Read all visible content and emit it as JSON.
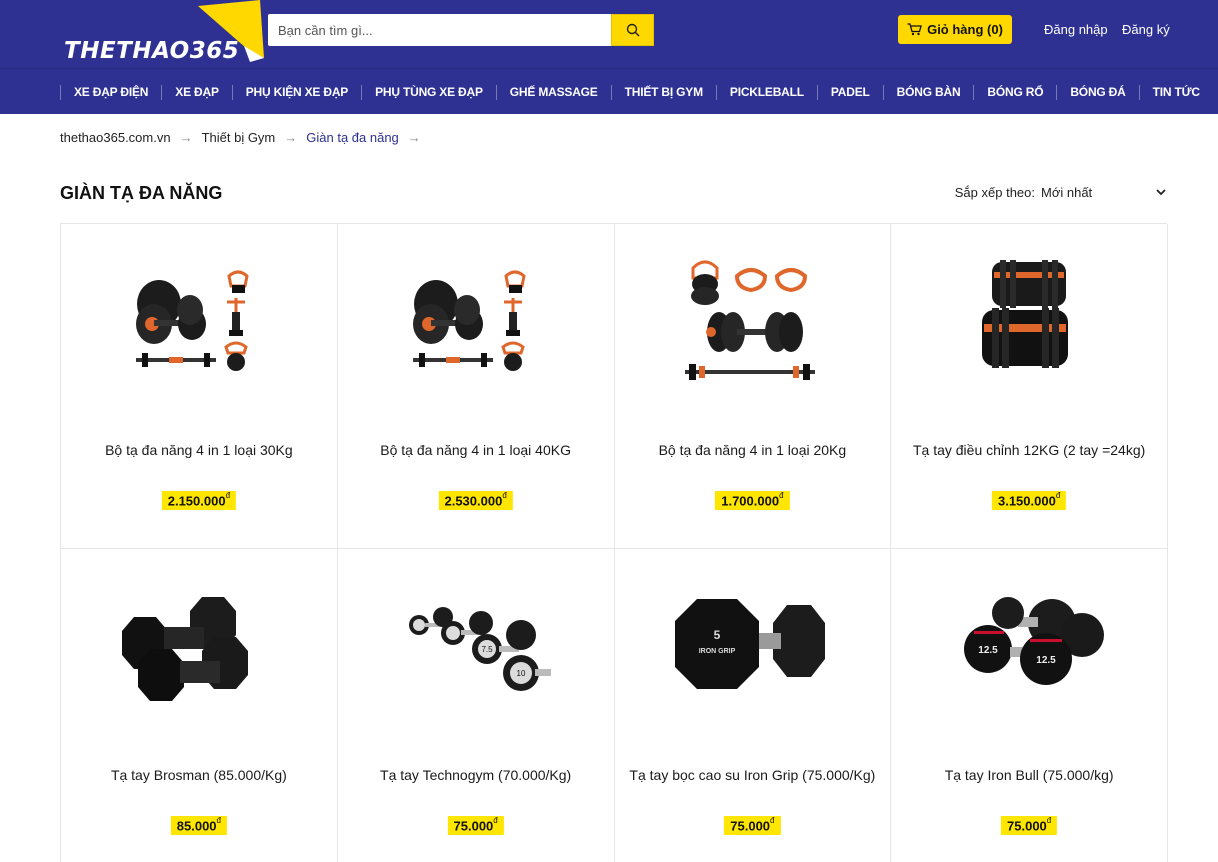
{
  "header": {
    "logo_text": "THETHAO365",
    "search_placeholder": "Bạn cần tìm gì...",
    "cart_label": "Giỏ hàng (0)",
    "login_label": "Đăng nhập",
    "register_label": "Đăng ký",
    "colors": {
      "brand": "#2e3192",
      "accent": "#ffd800"
    }
  },
  "nav": {
    "items": [
      "XE ĐẠP ĐIỆN",
      "XE ĐẠP",
      "PHỤ KIỆN XE ĐẠP",
      "PHỤ TÙNG XE ĐẠP",
      "GHẾ MASSAGE",
      "THIẾT BỊ GYM",
      "PICKLEBALL",
      "PADEL",
      "BÓNG BÀN",
      "BÓNG RỔ",
      "BÓNG ĐÁ",
      "TIN TỨC"
    ]
  },
  "breadcrumb": {
    "items": [
      "thethao365.com.vn",
      "Thiết bị Gym",
      "Giàn tạ đa năng"
    ],
    "separator": "→"
  },
  "page": {
    "title": "GIÀN TẠ ĐA NĂNG",
    "sort_label": "Sắp xếp theo:",
    "sort_value": "Mới nhất"
  },
  "products": [
    {
      "name": "Bộ tạ đa năng 4 in 1 loại 30Kg",
      "price": "2.150.000",
      "currency": "đ",
      "icon": "adjustable-dumbbell-set-icon"
    },
    {
      "name": "Bộ tạ đa năng 4 in 1 loại 40KG",
      "price": "2.530.000",
      "currency": "đ",
      "icon": "adjustable-dumbbell-set-icon"
    },
    {
      "name": "Bộ tạ đa năng 4 in 1 loại 20Kg",
      "price": "1.700.000",
      "currency": "đ",
      "icon": "kettlebell-dumbbell-set-icon"
    },
    {
      "name": "Tạ tay điều chỉnh 12KG (2 tay =24kg)",
      "price": "3.150.000",
      "currency": "đ",
      "icon": "adjustable-dumbbell-icon"
    },
    {
      "name": "Tạ tay Brosman (85.000/Kg)",
      "price": "85.000",
      "currency": "đ",
      "icon": "hex-dumbbell-pair-icon"
    },
    {
      "name": "Tạ tay Technogym (70.000/Kg)",
      "price": "75.000",
      "currency": "đ",
      "icon": "round-dumbbell-set-icon"
    },
    {
      "name": "Tạ tay bọc cao su Iron Grip (75.000/Kg)",
      "price": "75.000",
      "currency": "đ",
      "icon": "rubber-hex-dumbbell-icon"
    },
    {
      "name": "Tạ tay Iron Bull (75.000/kg)",
      "price": "75.000",
      "currency": "đ",
      "icon": "round-dumbbell-pair-icon"
    }
  ],
  "image_labels": {
    "p6": [
      "5",
      "IRON GRIP"
    ],
    "p5": [
      "7.5",
      "10"
    ],
    "p7": [
      "12.5",
      "12.5"
    ]
  }
}
